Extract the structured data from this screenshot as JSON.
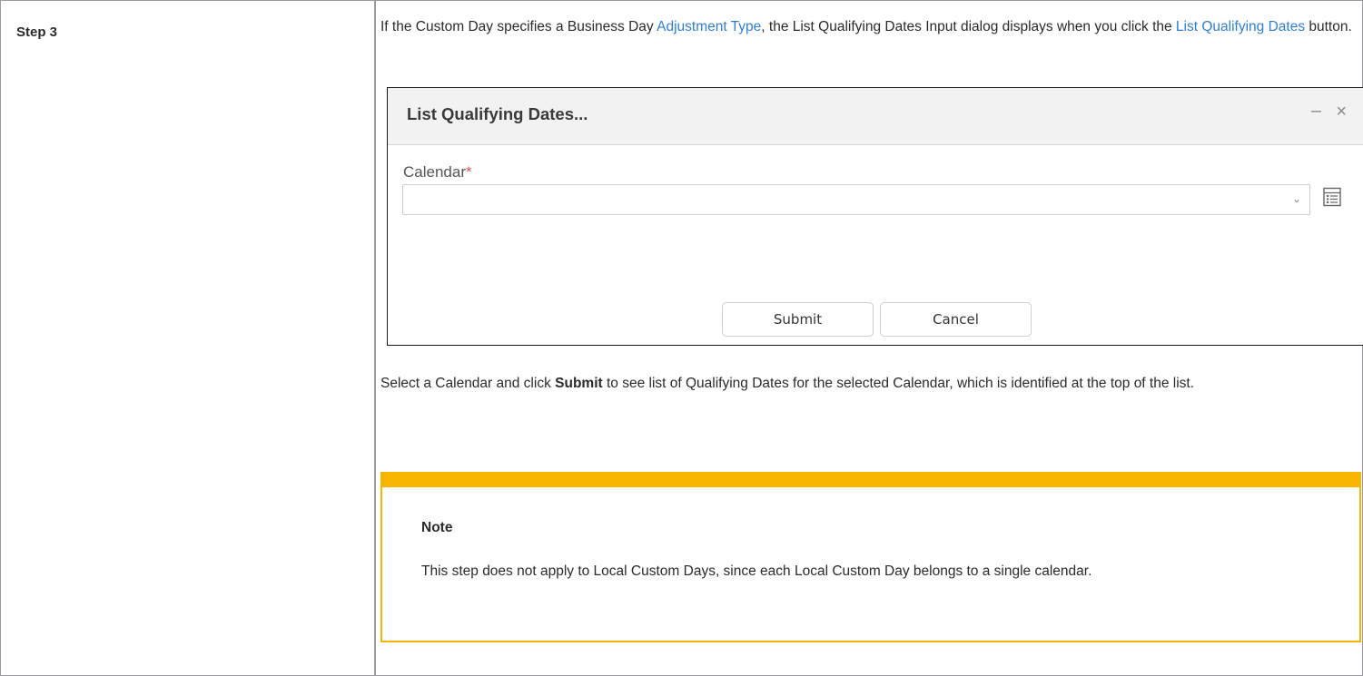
{
  "step": {
    "label": "Step 3"
  },
  "intro": {
    "part1": "If the Custom Day specifies a Business Day ",
    "link1": "Adjustment Type",
    "part2": ", the List Qualifying Dates Input dialog displays when you click the ",
    "link2": "List Qualifying Dates",
    "part3": " button."
  },
  "dialog": {
    "title": "List Qualifying Dates...",
    "minimize_glyph": "–",
    "close_glyph": "×",
    "calendar_label": "Calendar",
    "required_mark": "*",
    "calendar_value": "",
    "chevron_glyph": "⌄",
    "submit_label": "Submit",
    "cancel_label": "Cancel"
  },
  "instruction": {
    "part1": "Select a Calendar and click ",
    "bold": "Submit",
    "part2": " to see list of Qualifying Dates for the selected Calendar, which is identified at the top of the list."
  },
  "note": {
    "title": "Note",
    "body": "This step does not apply to Local Custom Days, since each Local Custom Day belongs to a single calendar."
  },
  "colors": {
    "link": "#2f7fd6",
    "note_accent": "#f7b500",
    "required": "#e05555"
  },
  "icons": {
    "list": "list-icon",
    "chevron": "chevron-down-icon",
    "minimize": "minimize-icon",
    "close": "close-icon"
  }
}
